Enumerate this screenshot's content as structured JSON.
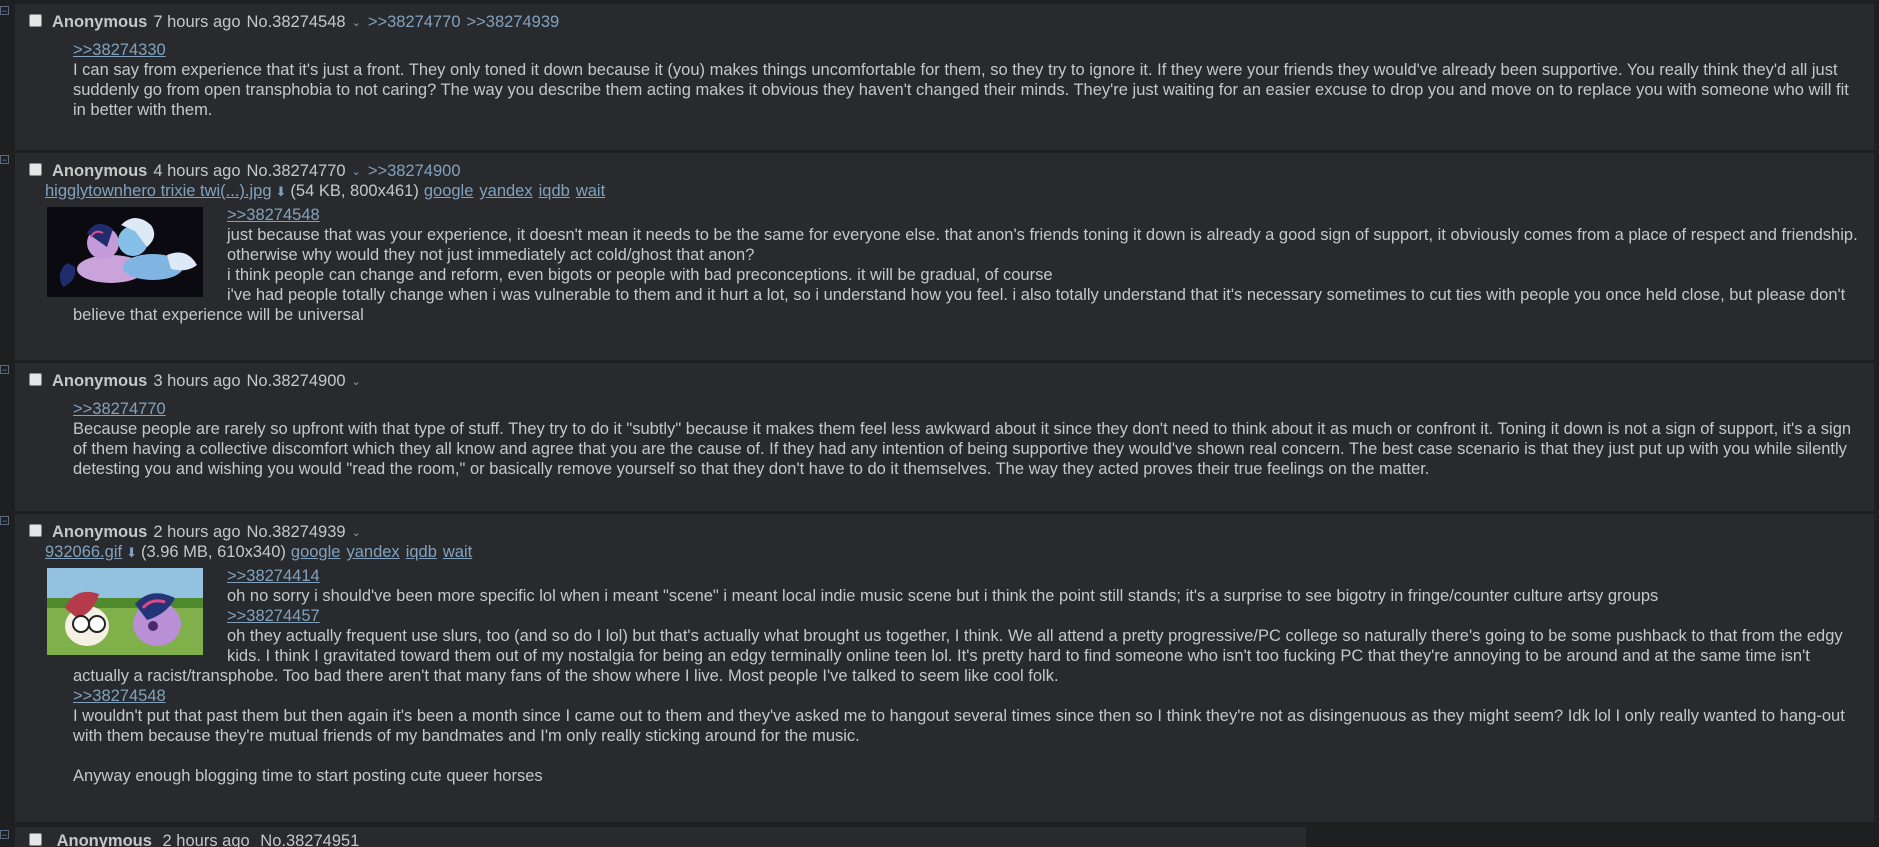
{
  "posts": [
    {
      "name": "Anonymous",
      "date": "7 hours ago",
      "number": "No.38274548",
      "backlinks": [
        ">>38274770",
        ">>38274939"
      ],
      "lines": [
        {
          "type": "quote",
          "text": ">>38274330"
        },
        {
          "type": "text",
          "text": "I can say from experience that it's just a front. They only toned it down because it (you) makes things uncomfortable for them, so they try to ignore it. If they were your friends they would've already been supportive. You really think they'd all just suddenly go from open transphobia to not caring? The way you describe them acting makes it obvious they haven't changed their minds. They're just waiting for an easier excuse to drop you and move on to replace you with someone who will fit in better with them."
        }
      ]
    },
    {
      "name": "Anonymous",
      "date": "4 hours ago",
      "number": "No.38274770",
      "backlinks": [
        ">>38274900"
      ],
      "file": {
        "name": "higglytownhero trixie twi(...).jpg",
        "info": "(54 KB, 800x461)",
        "search": [
          "google",
          "yandex",
          "iqdb",
          "wait"
        ]
      },
      "lines": [
        {
          "type": "quote",
          "text": ">>38274548"
        },
        {
          "type": "text",
          "text": "just because that was your experience, it doesn't mean it needs to be the same for everyone else. that anon's friends toning it down is already a good sign of support, it obviously comes from a place of respect and friendship. otherwise why would they not just immediately act cold/ghost that anon?"
        },
        {
          "type": "text",
          "text": "i think people can change and reform, even bigots or people with bad preconceptions. it will be gradual, of course"
        },
        {
          "type": "text",
          "text": "i've had people totally change when i was vulnerable to them and it hurt a lot, so i understand how you feel. i also totally understand that it's necessary sometimes to cut ties with people you once held close, but please don't believe that experience will be universal"
        }
      ]
    },
    {
      "name": "Anonymous",
      "date": "3 hours ago",
      "number": "No.38274900",
      "backlinks": [],
      "lines": [
        {
          "type": "quote",
          "text": ">>38274770"
        },
        {
          "type": "text",
          "text": "Because people are rarely so upfront with that type of stuff. They try to do it \"subtly\" because it makes them feel less awkward about it since they don't need to think about it as much or confront it. Toning it down is not a sign of support, it's a sign of them having a collective discomfort which they all know and agree that you are the cause of. If they had any intention of being supportive they would've shown real concern. The best case scenario is that they just put up with you while silently detesting you and wishing you would \"read the room,\" or basically remove yourself so that they don't have to do it themselves. The way they acted proves their true feelings on the matter."
        }
      ]
    },
    {
      "name": "Anonymous",
      "date": "2 hours ago",
      "number": "No.38274939",
      "backlinks": [],
      "file": {
        "name": "932066.gif",
        "info": "(3.96 MB, 610x340)",
        "search": [
          "google",
          "yandex",
          "iqdb",
          "wait"
        ]
      },
      "lines": [
        {
          "type": "quote",
          "text": ">>38274414"
        },
        {
          "type": "text",
          "text": "oh no sorry i should've been more specific lol when i meant \"scene\" i meant local indie music scene but i think the point still stands; it's a surprise to see bigotry in fringe/counter culture artsy groups"
        },
        {
          "type": "quote",
          "text": ">>38274457"
        },
        {
          "type": "text",
          "text": "oh they actually frequent use slurs, too (and so do I lol) but that's actually what brought us together, I think. We all attend a pretty progressive/PC college so naturally there's going to be some pushback to that from the edgy kids. I think I gravitated toward them out of my nostalgia for being an edgy terminally online teen lol. It's pretty hard to find someone who isn't too fucking PC that they're annoying to be around and at the same time isn't actually a racist/transphobe. Too bad there aren't that many fans of the show where I live. Most people I've talked to seem like cool folk."
        },
        {
          "type": "quote",
          "text": ">>38274548"
        },
        {
          "type": "text",
          "text": "I wouldn't put that past them but then again it's been a month since I came out to them and they've asked me to hangout several times since then so I think they're not as disingenuous as they might seem? Idk lol I only really wanted to hang-out with them because they're mutual friends of my bandmates and I'm only really sticking around for the music."
        },
        {
          "type": "blank",
          "text": ""
        },
        {
          "type": "text",
          "text": "Anyway enough blogging time to start posting cute queer horses"
        }
      ]
    }
  ],
  "partial_post": {
    "name": "Anonymous",
    "date": "2 hours ago",
    "number": "No.38274951"
  },
  "icons": {
    "hide": "minus-box-icon",
    "menu": "chevron-down-icon",
    "download": "download-icon"
  },
  "colors": {
    "background": "#1d1f21",
    "post": "#282a2e",
    "link": "#81a2be",
    "text": "#c5c8c6"
  }
}
